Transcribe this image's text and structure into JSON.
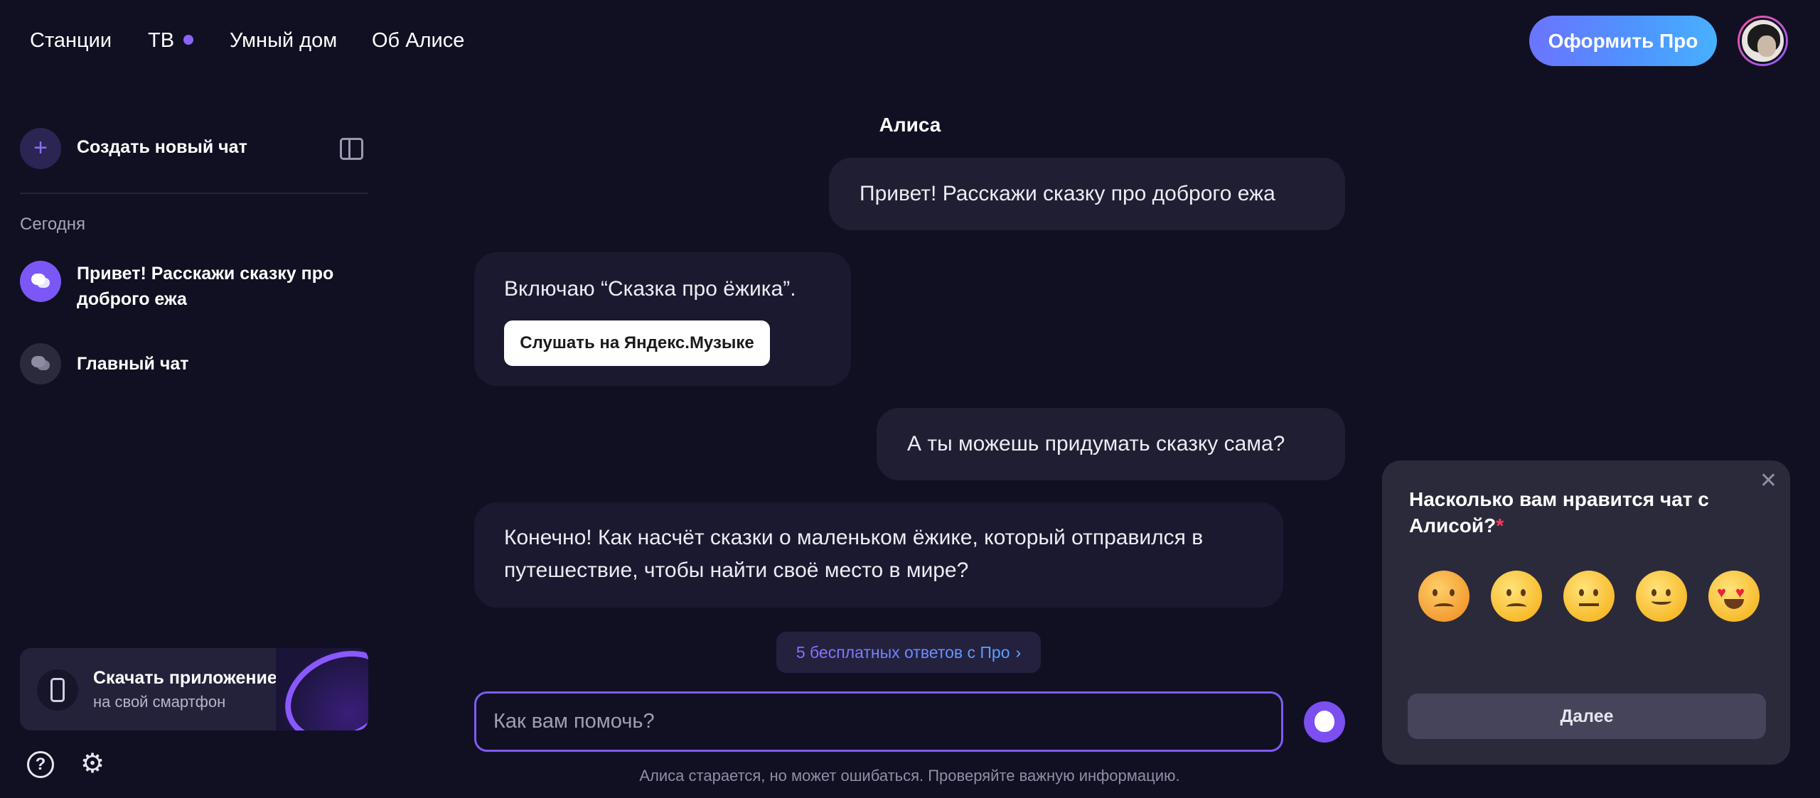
{
  "nav": {
    "items": [
      {
        "label": "Станции"
      },
      {
        "label": "ТВ"
      },
      {
        "label": "Умный дом"
      },
      {
        "label": "Об Алисе"
      }
    ],
    "pro_button": "Оформить Про",
    "tv_badge_color": "#8a63ff"
  },
  "sidebar": {
    "new_chat_label": "Создать новый чат",
    "section_today": "Сегодня",
    "chats": [
      {
        "label": "Привет! Расскажи сказку про доброго ежа",
        "active": true
      },
      {
        "label": "Главный чат",
        "active": false
      }
    ],
    "download": {
      "title": "Скачать приложение",
      "subtitle": "на свой смартфон"
    }
  },
  "chat": {
    "title": "Алиса",
    "messages": [
      {
        "role": "user",
        "text": "Привет! Расскажи сказку про доброго ежа"
      },
      {
        "role": "assistant",
        "text": "Включаю “Сказка про ёжика”.",
        "button": "Слушать на Яндекс.Музыке"
      },
      {
        "role": "user",
        "text": "А ты можешь придумать сказку сама?"
      },
      {
        "role": "assistant",
        "text": "Конечно! Как насчёт сказки о маленьком ёжике, который отправился в путешествие, чтобы найти своё место в мире?"
      }
    ],
    "free_answers": "5 бесплатных ответов с Про",
    "input_placeholder": "Как вам помочь?",
    "disclaimer": "Алиса старается, но может ошибаться. Проверяйте важную информацию."
  },
  "rating": {
    "question": "Насколько вам нравится чат с Алисой?",
    "required_mark": "*",
    "options": [
      "angry-face-icon",
      "frowning-face-icon",
      "neutral-face-icon",
      "smiling-face-icon",
      "heart-eyes-face-icon"
    ],
    "next_button": "Далее"
  },
  "colors": {
    "background": "#111022",
    "accent": "#7b58f5",
    "input_border": "#7d5cf5"
  }
}
